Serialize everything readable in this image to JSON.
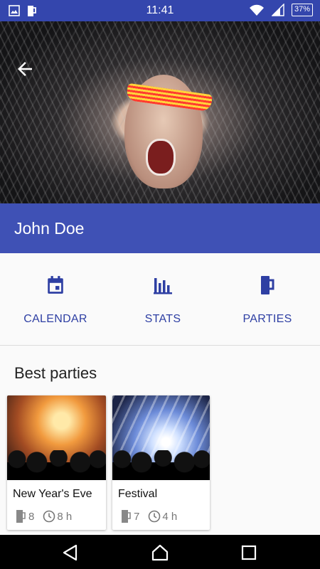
{
  "status_bar": {
    "time": "11:41",
    "battery": "37%"
  },
  "profile": {
    "name": "John Doe"
  },
  "actions": [
    {
      "label": "CALENDAR",
      "icon": "calendar-icon"
    },
    {
      "label": "STATS",
      "icon": "bar-chart-icon"
    },
    {
      "label": "PARTIES",
      "icon": "beer-mug-icon"
    }
  ],
  "best_parties": {
    "title": "Best parties",
    "items": [
      {
        "title": "New Year's Eve",
        "drinks": "8",
        "duration": "8 h"
      },
      {
        "title": "Festival",
        "drinks": "7",
        "duration": "4 h"
      }
    ]
  },
  "colors": {
    "primary": "#3f51b5",
    "status_bar": "#3446ad",
    "accent_text": "#2e3fa3"
  }
}
